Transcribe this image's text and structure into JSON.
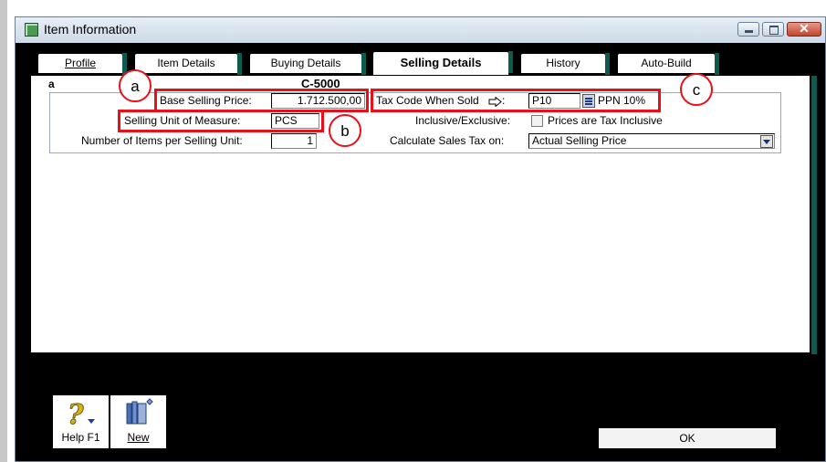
{
  "window": {
    "title": "Item Information",
    "close_glyph": "✕"
  },
  "tabs": [
    {
      "label": "Profile"
    },
    {
      "label": "Item Details"
    },
    {
      "label": "Buying Details"
    },
    {
      "label": "Selling Details"
    },
    {
      "label": "History"
    },
    {
      "label": "Auto-Build"
    }
  ],
  "active_tab": "Selling Details",
  "header": {
    "name": "a",
    "code": "C-5000"
  },
  "form": {
    "base_selling_price_label": "Base Selling Price:",
    "base_selling_price_value": "1.712.500,00",
    "selling_unit_label": "Selling Unit of Measure:",
    "selling_unit_value": "PCS",
    "items_per_unit_label": "Number of Items per Selling Unit:",
    "items_per_unit_value": "1",
    "tax_code_label": "Tax Code When Sold",
    "tax_code_value": "P10",
    "tax_code_desc": "PPN 10%",
    "inclusive_label": "Inclusive/Exclusive:",
    "inclusive_checkbox_label": "Prices are Tax Inclusive",
    "inclusive_checked": false,
    "calc_sales_tax_label": "Calculate Sales Tax on:",
    "calc_sales_tax_value": "Actual Selling Price"
  },
  "callouts": {
    "a": "a",
    "b": "b",
    "c": "c"
  },
  "toolbar": {
    "help_label": "Help F1",
    "new_label": "New",
    "ok_label": "OK"
  },
  "colors": {
    "annotation_red": "#e8101a",
    "tab_edge_teal": "#0c5b4e",
    "window_frame": "#c3cfd9"
  },
  "icons": {
    "window": "item-window-icon",
    "help": "help-question-icon",
    "new": "new-item-icon",
    "lookup": "list-lookup-icon",
    "arrow": "arrow-right-icon"
  }
}
